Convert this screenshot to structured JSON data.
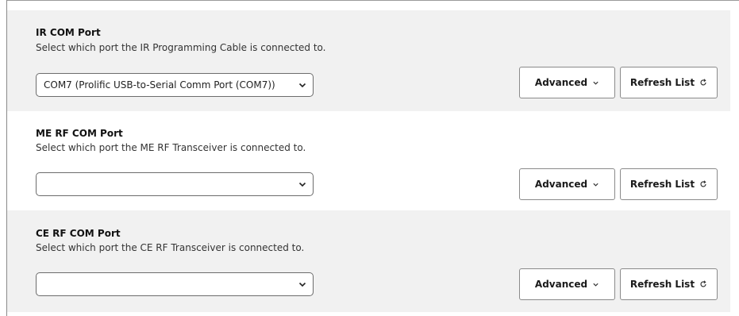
{
  "sections": [
    {
      "title": "IR COM Port",
      "description": "Select which port the IR Programming Cable is connected to.",
      "selected_port": "COM7 (Prolific USB-to-Serial Comm Port (COM7))",
      "advanced_label": "Advanced",
      "refresh_label": "Refresh List"
    },
    {
      "title": "ME RF COM Port",
      "description": "Select which port the ME RF Transceiver is connected to.",
      "selected_port": "",
      "advanced_label": "Advanced",
      "refresh_label": "Refresh List"
    },
    {
      "title": "CE RF COM Port",
      "description": "Select which port the CE RF Transceiver is connected to.",
      "selected_port": "",
      "advanced_label": "Advanced",
      "refresh_label": "Refresh List"
    }
  ],
  "icons": {
    "dropdown": "chevron-down-icon",
    "advanced": "chevron-down-icon",
    "refresh": "refresh-icon"
  },
  "colors": {
    "section_shaded_bg": "#f1f1f1",
    "section_plain_bg": "#ffffff",
    "border": "#8a8a8a",
    "text": "#1a1a1a"
  }
}
